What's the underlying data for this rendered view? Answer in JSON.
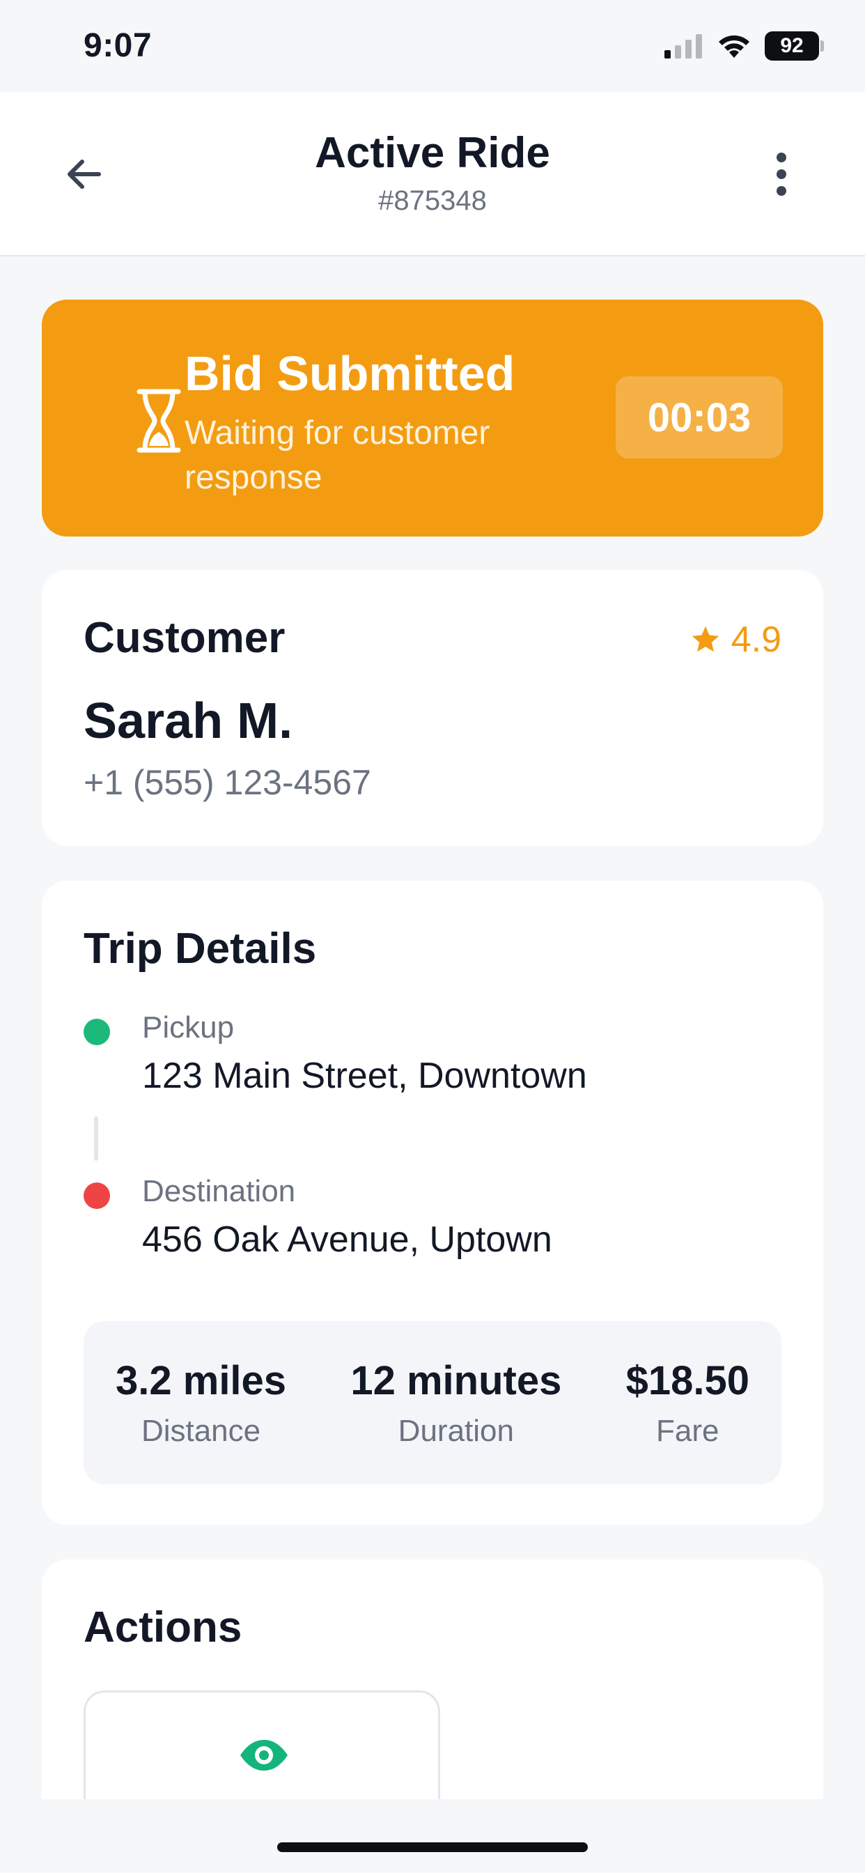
{
  "status_bar": {
    "time": "9:07",
    "battery": "92"
  },
  "header": {
    "title": "Active Ride",
    "ride_id": "#875348"
  },
  "bid_status": {
    "title": "Bid Submitted",
    "subtitle": "Waiting for customer response",
    "timer": "00:03",
    "color": "#f39c12"
  },
  "customer": {
    "heading": "Customer",
    "rating": "4.9",
    "name": "Sarah M.",
    "phone": "+1 (555) 123-4567"
  },
  "trip": {
    "heading": "Trip Details",
    "pickup": {
      "label": "Pickup",
      "address": "123 Main Street, Downtown",
      "color": "#1db97a"
    },
    "destination": {
      "label": "Destination",
      "address": "456 Oak Avenue, Uptown",
      "color": "#ef4444"
    },
    "stats": [
      {
        "value": "3.2 miles",
        "label": "Distance"
      },
      {
        "value": "12 minutes",
        "label": "Duration"
      },
      {
        "value": "$18.50",
        "label": "Fare"
      }
    ]
  },
  "actions": {
    "heading": "Actions",
    "first_action_icon": "eye-icon"
  }
}
